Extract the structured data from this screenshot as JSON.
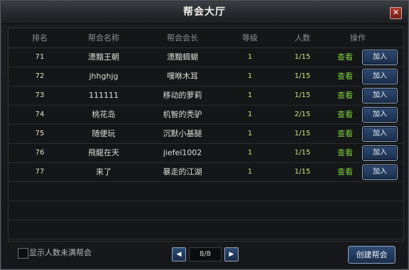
{
  "window": {
    "title": "帮会大厅",
    "close_label": "✕"
  },
  "table": {
    "headers": [
      "排名",
      "帮会名称",
      "帮会会长",
      "等级",
      "人数",
      "操作"
    ],
    "rows": [
      {
        "rank": "71",
        "name": "漶黯王朝",
        "leader": "漶黯蜩蝴",
        "level": "1",
        "members": "1/15",
        "view": "查看",
        "join": "加入"
      },
      {
        "rank": "72",
        "name": "jhhghjg",
        "leader": "嘿咻木耳",
        "level": "1",
        "members": "1/15",
        "view": "查看",
        "join": "加入"
      },
      {
        "rank": "73",
        "name": "111111",
        "leader": "移动的萝莉",
        "level": "1",
        "members": "1/15",
        "view": "查看",
        "join": "加入"
      },
      {
        "rank": "74",
        "name": "桃花岛",
        "leader": "机智的秃驴",
        "level": "1",
        "members": "2/15",
        "view": "查看",
        "join": "加入"
      },
      {
        "rank": "75",
        "name": "随便玩",
        "leader": "沉默小基腿",
        "level": "1",
        "members": "1/15",
        "view": "查看",
        "join": "加入"
      },
      {
        "rank": "76",
        "name": "飛龍在天",
        "leader": "jiefei1002",
        "level": "1",
        "members": "1/15",
        "view": "查看",
        "join": "加入"
      },
      {
        "rank": "77",
        "name": "来了",
        "leader": "暴走的江湖",
        "level": "1",
        "members": "1/15",
        "view": "查看",
        "join": "加入"
      }
    ]
  },
  "footer": {
    "checkbox_label": "显示人数未满帮会",
    "checkbox_checked": false,
    "page_indicator": "8/8",
    "prev_icon": "◀",
    "next_icon": "▶",
    "create_label": "创建帮会"
  }
}
